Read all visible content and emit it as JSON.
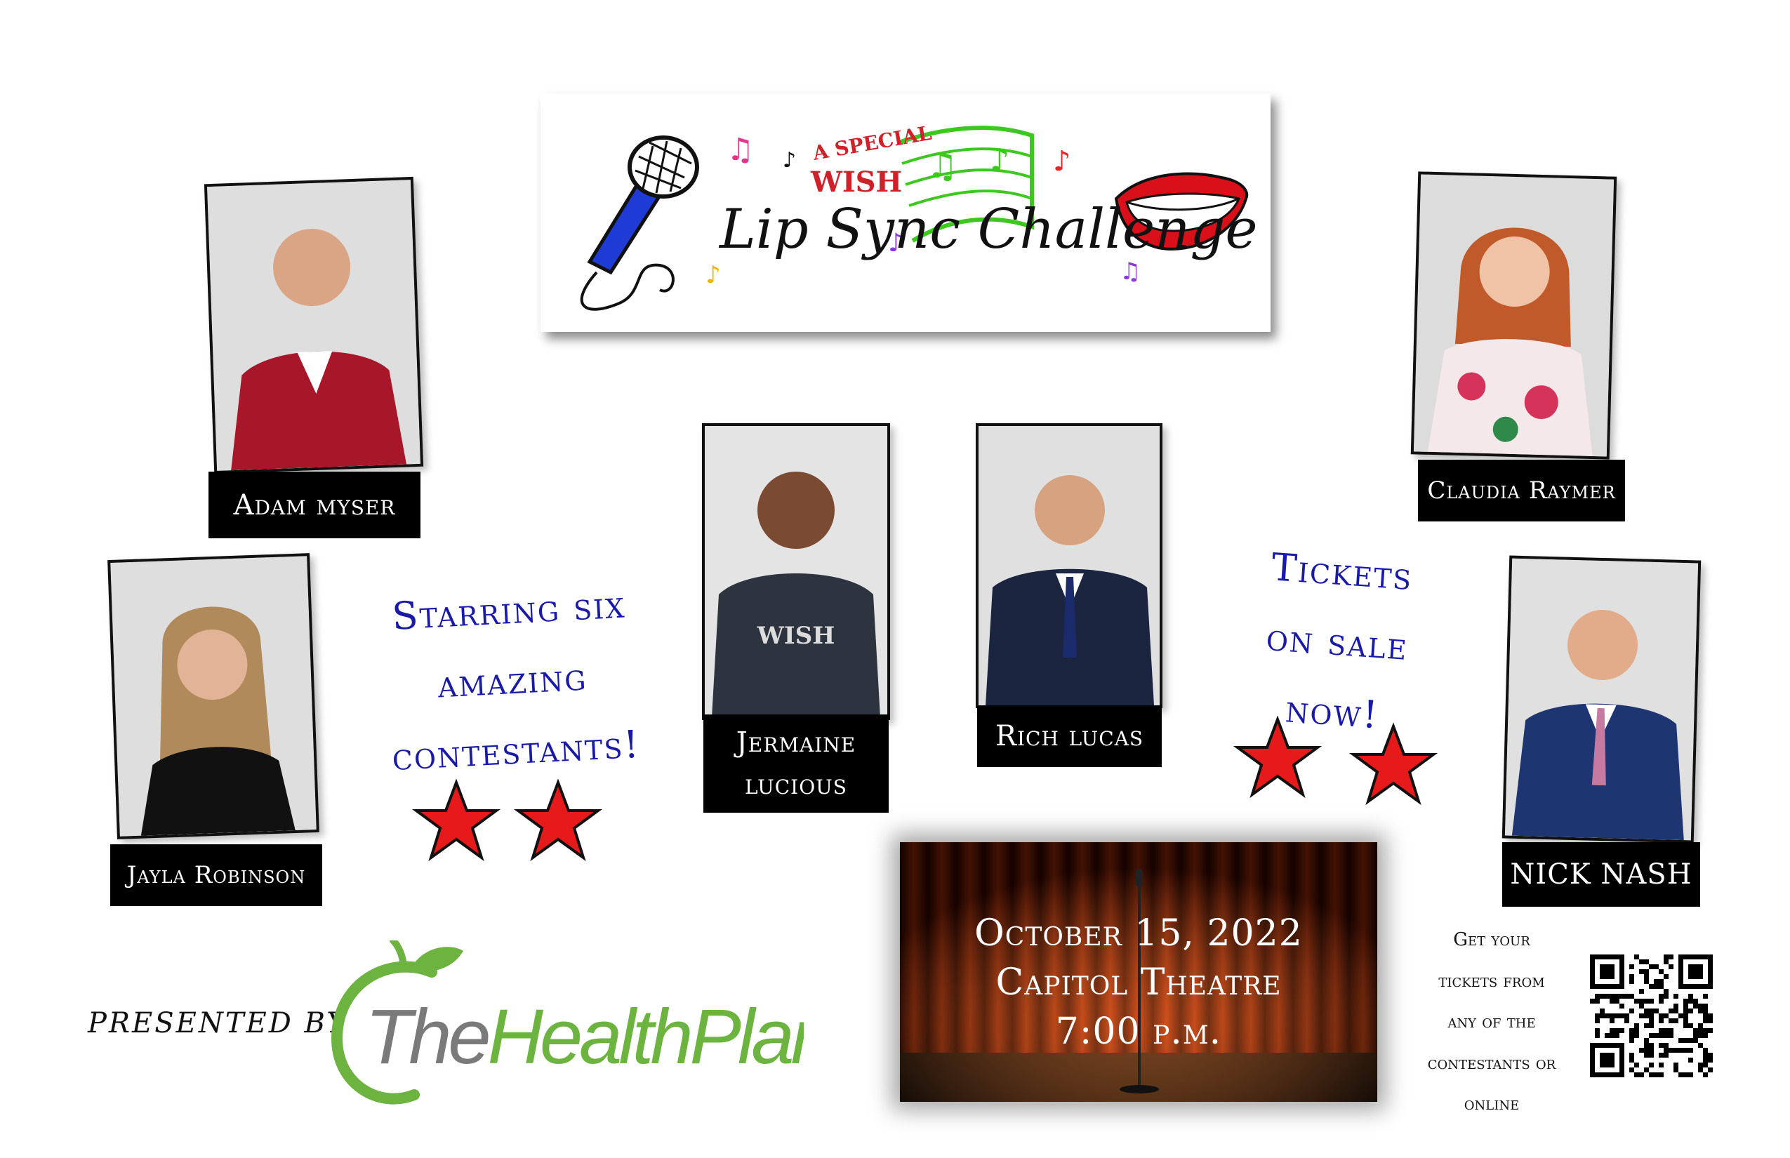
{
  "event": {
    "logo_line1": "A SPECIAL",
    "logo_line2": "WISH",
    "logo_title": "Lip Sync Challenge",
    "date": "October 15, 2022",
    "venue": "Capitol Theatre",
    "time": "7:00 p.m."
  },
  "contestants": [
    {
      "name": "Adam myser"
    },
    {
      "name": "Jayla Robinson"
    },
    {
      "name": "Jermaine lucious"
    },
    {
      "name": "Rich lucas"
    },
    {
      "name": "Claudia Raymer"
    },
    {
      "name": "NICK NASH"
    }
  ],
  "promo": {
    "starring_line1": "Starring six",
    "starring_line2": "amazing",
    "starring_line3": "contestants!",
    "tickets_line1": "Tickets",
    "tickets_line2": "on sale",
    "tickets_line3": "now!"
  },
  "tickets_note": {
    "line1": "Get your",
    "line2": "tickets from",
    "line3": "any of the",
    "line4": "contestants or",
    "line5": "online"
  },
  "sponsor": {
    "presented_by": "PRESENTED BY",
    "name_part1": "The",
    "name_part2": "HealthPlan"
  },
  "colors": {
    "star": "#e61a1a",
    "handwriting": "#1a1aa8",
    "sponsor_green": "#6cb33f",
    "sponsor_gray": "#7a7a7a"
  },
  "icons": [
    "microphone-icon",
    "lips-icon",
    "music-note-icon",
    "star-icon",
    "qr-code-icon",
    "apple-icon"
  ]
}
